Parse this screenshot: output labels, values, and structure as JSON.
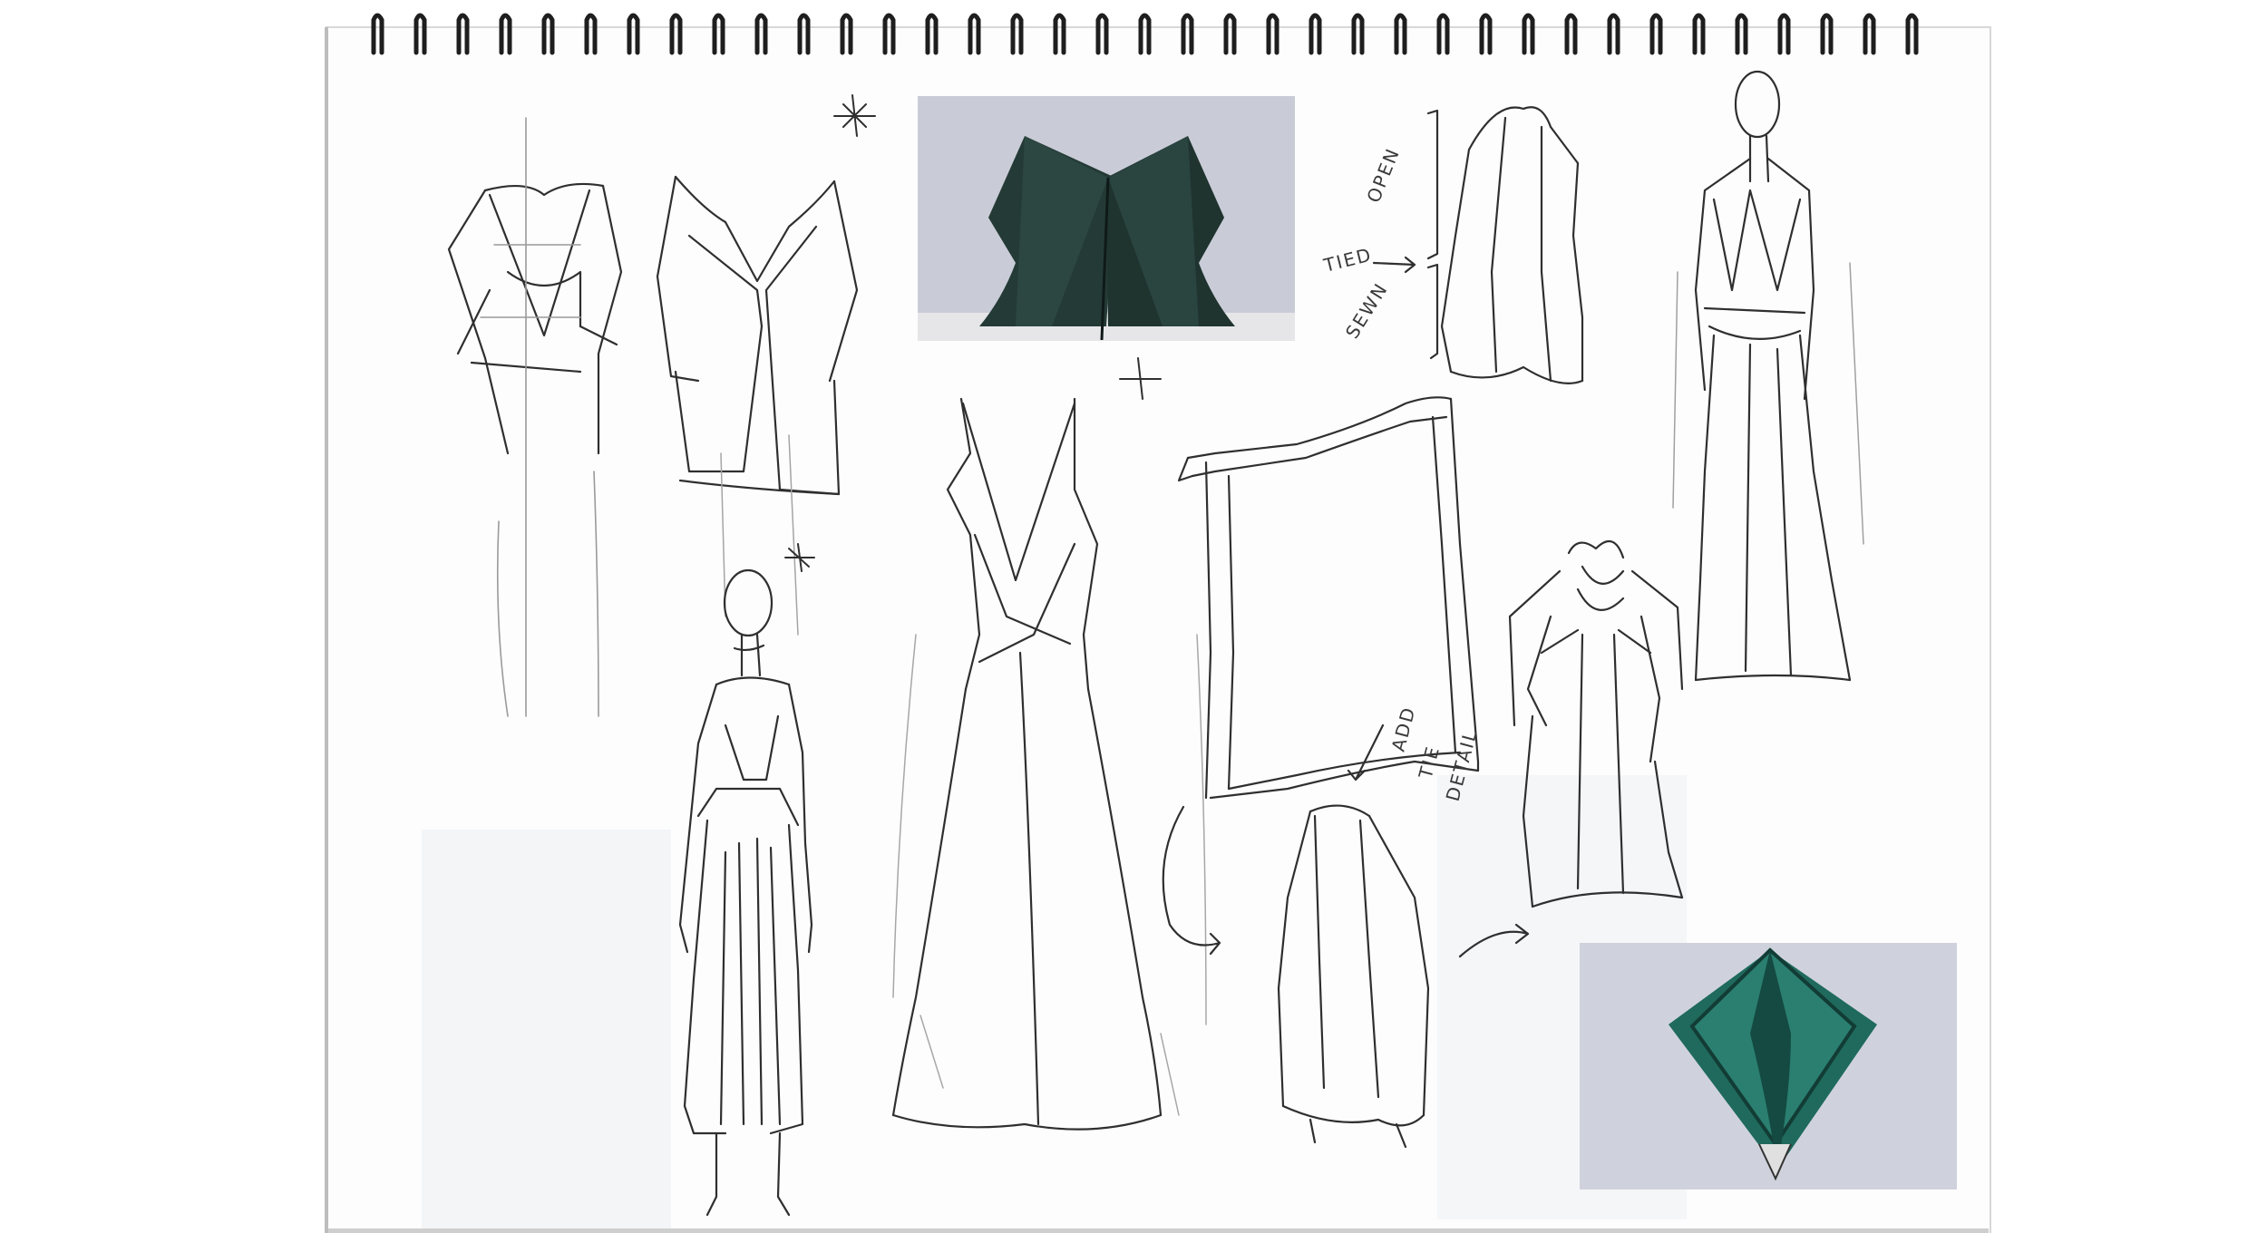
{
  "annotations": {
    "open": "OPEN",
    "tied": "TIED",
    "sewn": "SEWN",
    "add_line1": "ADD",
    "add_line2": "TIE",
    "add_line3": "DETAIL"
  },
  "colors": {
    "page": "#fdfdfd",
    "pencil": "#2f2f2f",
    "pencil_light": "#9a9a9a",
    "ring": "#1e1e1e",
    "photo1_bg": "#c9ccd6",
    "photo1_fabric": "#243a36",
    "photo2_bg": "#cfd2dc",
    "photo2_fabric": "#1f6a5c"
  },
  "icons": {
    "spiral_binding": "spiral-binding-icon",
    "sparkle": "sparkle-icon",
    "arrow": "arrow-icon"
  }
}
